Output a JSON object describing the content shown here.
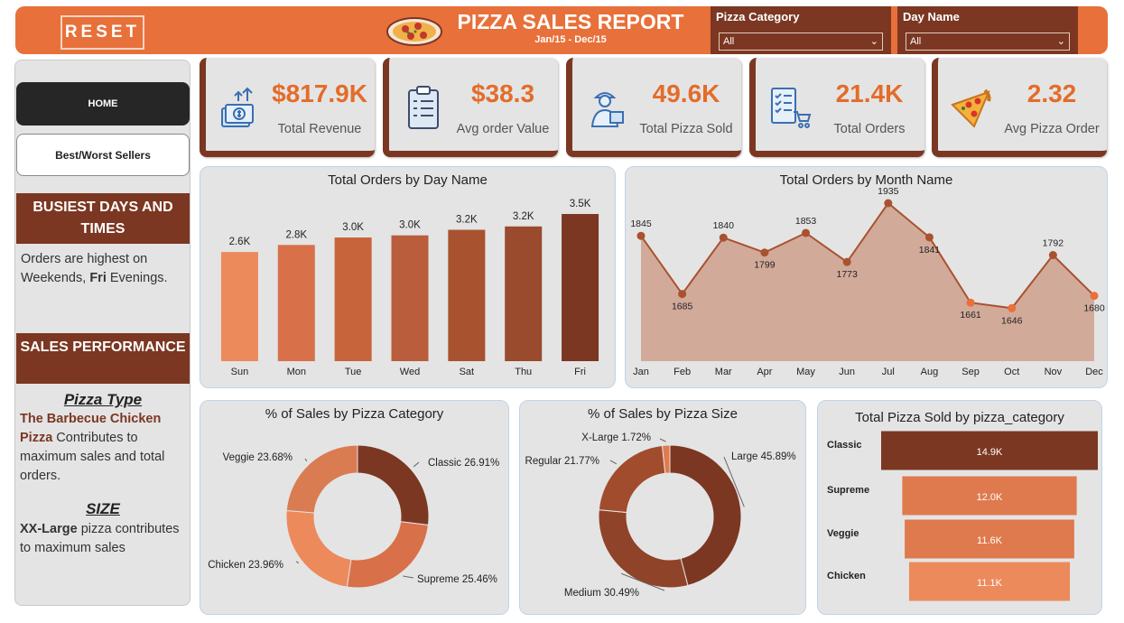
{
  "header": {
    "reset_label": "RESET",
    "title": "PIZZA SALES REPORT",
    "subtitle": "Jan/15 - Dec/15",
    "slicers": [
      {
        "label": "Pizza Category",
        "value": "All"
      },
      {
        "label": "Day Name",
        "value": "All"
      }
    ]
  },
  "nav": {
    "home_label": "HOME",
    "best_worst_label": "Best/Worst Sellers"
  },
  "insights": {
    "busiest_title": "BUSIEST DAYS AND TIMES",
    "busiest_pre": "Orders are highest on Weekends, ",
    "busiest_bold": "Fri",
    "busiest_post": " Evenings.",
    "sales_title": "SALES PERFORMANCE",
    "pizza_type_title": "Pizza Type",
    "pizza_type_highlight": "The Barbecue Chicken Pizza",
    "pizza_type_rest": " Contributes to maximum sales and total orders.",
    "size_title": "SIZE",
    "size_bold": "XX-Large",
    "size_rest": " pizza contributes to maximum sales"
  },
  "kpis": [
    {
      "value": "$817.9K",
      "label": "Total Revenue",
      "icon": "money-icon"
    },
    {
      "value": "$38.3",
      "label": "Avg order Value",
      "icon": "clipboard-icon"
    },
    {
      "value": "49.6K",
      "label": "Total Pizza Sold",
      "icon": "delivery-person-icon"
    },
    {
      "value": "21.4K",
      "label": "Total Orders",
      "icon": "checklist-cart-icon"
    },
    {
      "value": "2.32",
      "label": "Avg Pizza Order",
      "icon": "pizza-slice-icon"
    }
  ],
  "colors": {
    "header": "#e8703a",
    "dark_brown": "#7b3722",
    "kpi_value": "#e36c2a",
    "panel_bg": "#e4e4e4"
  },
  "chart_data": [
    {
      "type": "bar",
      "title": "Total Orders by Day Name",
      "categories": [
        "Sun",
        "Mon",
        "Tue",
        "Wed",
        "Sat",
        "Thu",
        "Fri"
      ],
      "values": [
        2624,
        2794,
        2973,
        3024,
        3158,
        3239,
        3538
      ],
      "labels": [
        "2.6K",
        "2.8K",
        "3.0K",
        "3.0K",
        "3.2K",
        "3.2K",
        "3.5K"
      ],
      "colors": [
        "#ec8a5c",
        "#d8704a",
        "#c8643c",
        "#b95d3c",
        "#a9522f",
        "#9a4a2d",
        "#7b3722"
      ]
    },
    {
      "type": "area",
      "title": "Total Orders by Month Name",
      "categories": [
        "Jan",
        "Feb",
        "Mar",
        "Apr",
        "May",
        "Jun",
        "Jul",
        "Aug",
        "Sep",
        "Oct",
        "Nov",
        "Dec"
      ],
      "values": [
        1845,
        1685,
        1840,
        1799,
        1853,
        1773,
        1935,
        1841,
        1661,
        1646,
        1792,
        1680
      ],
      "colors": {
        "line": "#a9522f",
        "fill": "#d2aa9a",
        "point": "#a9522f",
        "highlight_point": "#e8703a"
      }
    },
    {
      "type": "pie",
      "title": "% of Sales by Pizza Category",
      "categories": [
        "Classic",
        "Supreme",
        "Chicken",
        "Veggie"
      ],
      "values": [
        26.91,
        25.46,
        23.96,
        23.68
      ],
      "labels": [
        "Classic 26.91%",
        "Supreme 25.46%",
        "Chicken 23.96%",
        "Veggie 23.68%"
      ],
      "colors": [
        "#7b3722",
        "#d8704a",
        "#ec8a5c",
        "#d97c52"
      ]
    },
    {
      "type": "pie",
      "title": "% of Sales by Pizza Size",
      "categories": [
        "Large",
        "Medium",
        "Regular",
        "X-Large"
      ],
      "values": [
        45.89,
        30.49,
        21.77,
        1.72
      ],
      "labels": [
        "Large 45.89%",
        "Medium 30.49%",
        "Regular 21.77%",
        "X-Large 1.72%"
      ],
      "colors": [
        "#7b3722",
        "#8f4329",
        "#a14c2d",
        "#e27a4d"
      ]
    },
    {
      "type": "bar",
      "orientation": "horizontal",
      "title": "Total Pizza Sold by pizza_category",
      "categories": [
        "Classic",
        "Supreme",
        "Veggie",
        "Chicken"
      ],
      "values": [
        14888,
        11987,
        11649,
        11050
      ],
      "labels": [
        "14.9K",
        "12.0K",
        "11.6K",
        "11.1K"
      ],
      "colors": [
        "#7b3722",
        "#df7a4e",
        "#df7a4e",
        "#ec8a5c"
      ]
    }
  ]
}
